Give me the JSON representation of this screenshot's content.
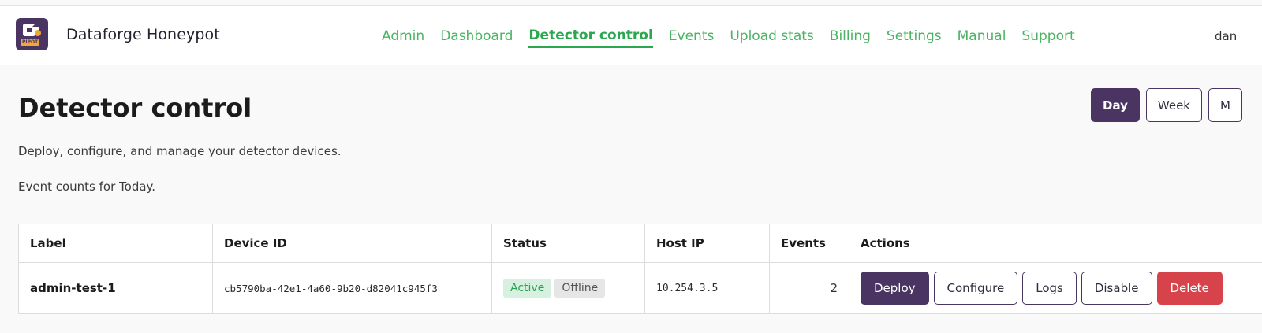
{
  "app": {
    "name": "Dataforge Honeypot",
    "logo_badge": "PIPOT",
    "user": "dan"
  },
  "nav": [
    {
      "label": "Admin",
      "active": false
    },
    {
      "label": "Dashboard",
      "active": false
    },
    {
      "label": "Detector control",
      "active": true
    },
    {
      "label": "Events",
      "active": false
    },
    {
      "label": "Upload stats",
      "active": false
    },
    {
      "label": "Billing",
      "active": false
    },
    {
      "label": "Settings",
      "active": false
    },
    {
      "label": "Manual",
      "active": false
    },
    {
      "label": "Support",
      "active": false
    }
  ],
  "page": {
    "title": "Detector control",
    "description": "Deploy, configure, and manage your detector devices.",
    "counts_note": "Event counts for Today."
  },
  "range": {
    "day": "Day",
    "week": "Week",
    "month": "M",
    "selected": "Day"
  },
  "table": {
    "columns": [
      "Label",
      "Device ID",
      "Status",
      "Host IP",
      "Events",
      "Actions"
    ],
    "rows": [
      {
        "label": "admin-test-1",
        "device_id": "cb5790ba-42e1-4a60-9b20-d82041c945f3",
        "status_active": "Active",
        "status_offline": "Offline",
        "host_ip": "10.254.3.5",
        "events": "2",
        "actions": {
          "deploy": "Deploy",
          "configure": "Configure",
          "logs": "Logs",
          "disable": "Disable",
          "delete": "Delete"
        }
      }
    ]
  },
  "colors": {
    "brand": "#4a3562",
    "nav_link": "#4bb364",
    "active_badge": "#2f9e55",
    "danger": "#d7434a"
  }
}
